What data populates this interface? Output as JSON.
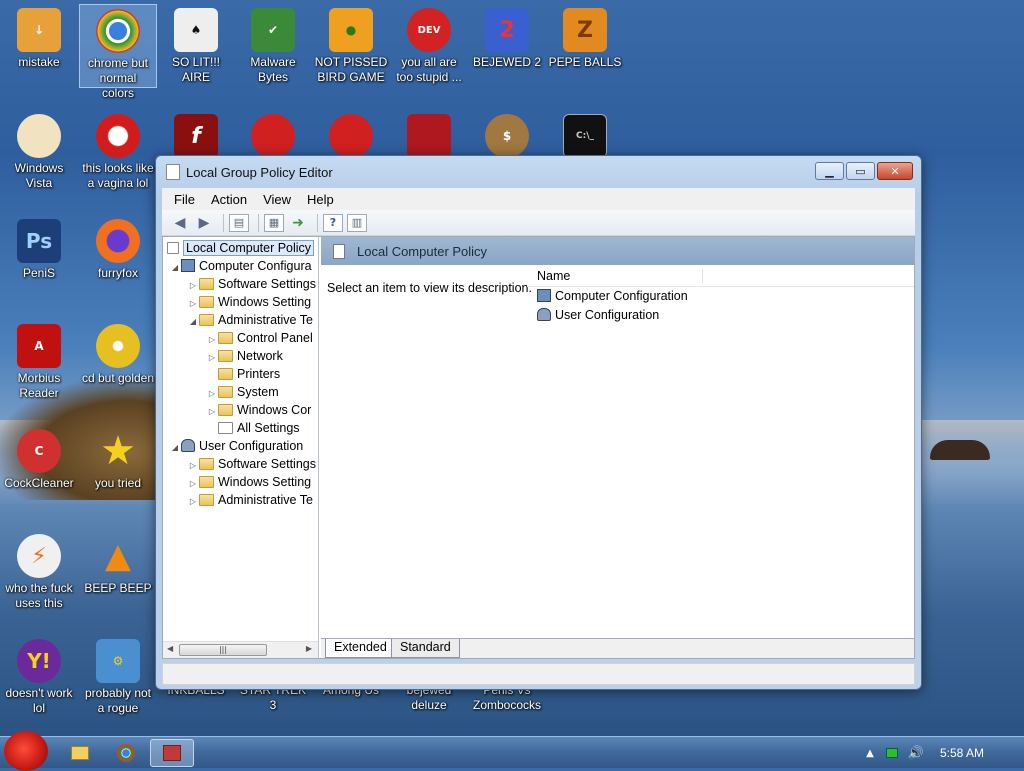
{
  "desktop": {
    "icons": [
      {
        "label": "mistake",
        "icon": "folder-arrow-icon",
        "color": "#e6a13a"
      },
      {
        "label": "chrome but normal colors",
        "icon": "chrome-icon",
        "color": "#2a8f3d"
      },
      {
        "label": "SO LIT!!! AIRE",
        "icon": "cards-icon",
        "color": "#eeeeee"
      },
      {
        "label": "Malware Bytes",
        "icon": "shield-icon",
        "color": "#3a8a3a"
      },
      {
        "label": "NOT PISSED BIRD GAME",
        "icon": "green-pig-icon",
        "color": "#f0a020"
      },
      {
        "label": "you all are too stupid ...",
        "icon": "devcpp-icon",
        "color": "#d22222"
      },
      {
        "label": "BEJEWED 2",
        "icon": "bejeweled-icon",
        "color": "#3a5fd0"
      },
      {
        "label": "PEPE BALLS",
        "icon": "zuma-icon",
        "color": "#e08a20"
      },
      {
        "label": "Windows Vista",
        "icon": "egg-icon",
        "color": "#f2e3c0"
      },
      {
        "label": "this looks like a vagina lol",
        "icon": "opera-icon",
        "color": "#d21c1c"
      },
      {
        "label": "",
        "icon": "flash-icon",
        "color": "#8a1010"
      },
      {
        "label": "",
        "icon": "angry-bird-icon",
        "color": "#d02020"
      },
      {
        "label": "",
        "icon": "angry-bird-2-icon",
        "color": "#d02020"
      },
      {
        "label": "",
        "icon": "logo-icon",
        "color": "#b01820"
      },
      {
        "label": "",
        "icon": "money-bag-icon",
        "color": "#a07840"
      },
      {
        "label": "",
        "icon": "cmd-icon",
        "color": "#111111"
      },
      {
        "label": "PeniS",
        "icon": "photoshop-icon",
        "color": "#1c3f7a"
      },
      {
        "label": "furryfox",
        "icon": "firefox-icon",
        "color": "#f07020"
      },
      {
        "label": "Morbius Reader",
        "icon": "acrobat-icon",
        "color": "#c01010"
      },
      {
        "label": "cd but golden",
        "icon": "cd-icon",
        "color": "#e6c020"
      },
      {
        "label": "CockCleaner",
        "icon": "ccleaner-icon",
        "color": "#d03030"
      },
      {
        "label": "you tried",
        "icon": "star-icon",
        "color": "#f5d020"
      },
      {
        "label": "who the fuck uses this",
        "icon": "avast-icon",
        "color": "#f0f0f0"
      },
      {
        "label": "BEEP BEEP",
        "icon": "vlc-icon",
        "color": "#f08a10"
      },
      {
        "label": "doesn't work lol",
        "icon": "yahoo-icon",
        "color": "#6a2a9a"
      },
      {
        "label": "probably not a rogue",
        "icon": "control-panel-icon",
        "color": "#4a90d0"
      },
      {
        "label": "INKBALLS",
        "icon": "",
        "color": ""
      },
      {
        "label": "STAR TREK 3",
        "icon": "",
        "color": ""
      },
      {
        "label": "Among Us",
        "icon": "",
        "color": ""
      },
      {
        "label": "bejewed deluze",
        "icon": "",
        "color": ""
      },
      {
        "label": "Penis Vs Zombococks",
        "icon": "",
        "color": ""
      }
    ]
  },
  "window": {
    "title": "Local Group Policy Editor",
    "menu": [
      "File",
      "Action",
      "View",
      "Help"
    ],
    "tree": [
      {
        "label": "Local Computer Policy",
        "expander": ""
      },
      {
        "label": "Computer Configura",
        "expander": "◢"
      },
      {
        "label": "Software Settings",
        "expander": "▷"
      },
      {
        "label": "Windows Setting",
        "expander": "▷"
      },
      {
        "label": "Administrative Te",
        "expander": "◢"
      },
      {
        "label": "Control Panel",
        "expander": "▷"
      },
      {
        "label": "Network",
        "expander": "▷"
      },
      {
        "label": "Printers",
        "expander": ""
      },
      {
        "label": "System",
        "expander": "▷"
      },
      {
        "label": "Windows Cor",
        "expander": "▷"
      },
      {
        "label": "All Settings",
        "expander": ""
      },
      {
        "label": "User Configuration",
        "expander": "◢"
      },
      {
        "label": "Software Settings",
        "expander": "▷"
      },
      {
        "label": "Windows Setting",
        "expander": "▷"
      },
      {
        "label": "Administrative Te",
        "expander": "▷"
      }
    ],
    "right_header": "Local Computer Policy",
    "description": "Select an item to view its description.",
    "list_column": "Name",
    "list_items": [
      "Computer Configuration",
      "User Configuration"
    ],
    "tabs": [
      "Extended",
      "Standard"
    ]
  },
  "taskbar": {
    "clock": "5:58 AM"
  }
}
